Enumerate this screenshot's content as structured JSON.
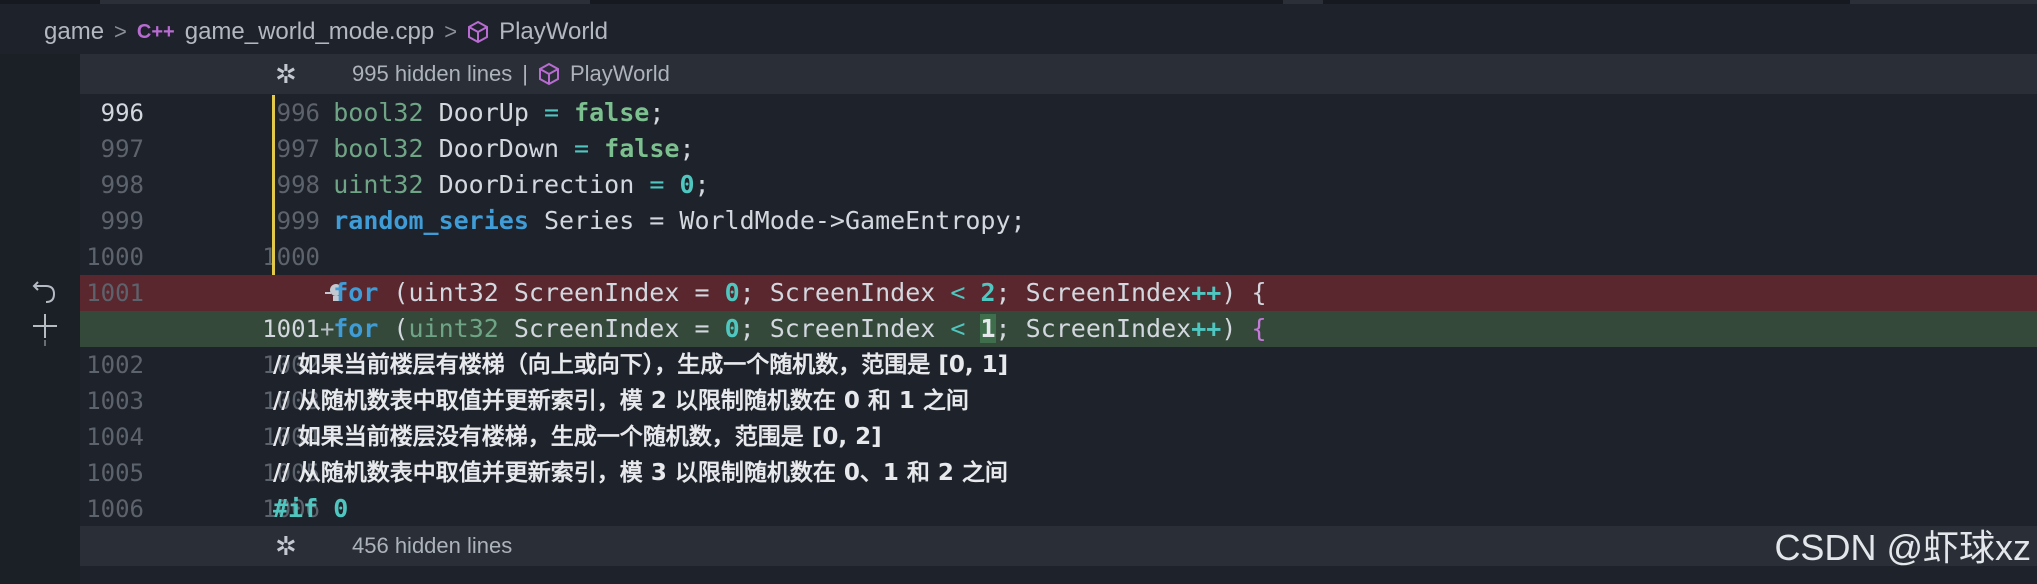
{
  "breadcrumb": {
    "items": [
      "game",
      "game_world_mode.cpp",
      "PlayWorld"
    ],
    "cpp_icon": "C++",
    "separator": ">"
  },
  "fold_top": {
    "text": "995 hidden lines",
    "divider": "|",
    "symbol": "PlayWorld"
  },
  "fold_bottom": {
    "text": "456 hidden lines"
  },
  "lines": [
    {
      "old": "996",
      "new": "996"
    },
    {
      "old": "997",
      "new": "997"
    },
    {
      "old": "998",
      "new": "998"
    },
    {
      "old": "999",
      "new": "999"
    },
    {
      "old": "1000",
      "new": "1000"
    },
    {
      "old": "1001",
      "new": ""
    },
    {
      "old": "",
      "new": "1001"
    },
    {
      "old": "1002",
      "new": "1002"
    },
    {
      "old": "1003",
      "new": "1003"
    },
    {
      "old": "1004",
      "new": "1004"
    },
    {
      "old": "1005",
      "new": "1005"
    },
    {
      "old": "1006",
      "new": "1006"
    }
  ],
  "code": {
    "l0": {
      "type": "bool32",
      "name": " DoorUp ",
      "eq": "=",
      "val": "false",
      "end": ";"
    },
    "l1": {
      "type": "bool32",
      "name": " DoorDown ",
      "eq": "=",
      "val": "false",
      "end": ";"
    },
    "l2": {
      "type": "uint32",
      "name": " DoorDirection ",
      "eq": "=",
      "val": "0",
      "end": ";"
    },
    "l3": {
      "type": "random_series",
      "rest": " Series = WorldMode->GameEntropy;"
    },
    "l5": {
      "for": "for",
      "open": " (",
      "type": "uint32",
      "decl": " ScreenIndex = ",
      "zero": "0",
      "mid": "; ScreenIndex ",
      "lt": "<",
      "limit": "2",
      "tail1": "; ScreenIndex",
      "pp": "++",
      "close": ") ",
      "brace": "{"
    },
    "l6": {
      "for": "for",
      "open": " (",
      "type": "uint32",
      "decl": " ScreenIndex = ",
      "zero": "0",
      "mid": "; ScreenIndex ",
      "lt": "<",
      "limit": "1",
      "tail1": "; ScreenIndex",
      "pp": "++",
      "close": ") ",
      "brace": "{"
    },
    "l7": "// 如果当前楼层有楼梯（向上或向下），生成一个随机数，范围是 [0, 1]",
    "l8": "// 从随机数表中取值并更新索引，模 2 以限制随机数在 0 和 1 之间",
    "l9": "// 如果当前楼层没有楼梯，生成一个随机数，范围是 [0, 2]",
    "l10": "// 从随机数表中取值并更新索引，模 3 以限制随机数在 0、1 和 2 之间",
    "l11": {
      "kw": "#if",
      "val": "0"
    }
  },
  "added_marker": "+",
  "watermark": "CSDN @虾球xz",
  "icons": {
    "fold": "snowflake-fold-icon",
    "symbol": "cube-icon",
    "revert": "revert-arrow-icon",
    "add": "plus-icon",
    "bulb": "lightbulb-icon"
  },
  "colors": {
    "deleted_line": "#5a272e",
    "added_line": "#34493a",
    "modified_bar": "#e2c94b",
    "background": "#1e222a"
  }
}
